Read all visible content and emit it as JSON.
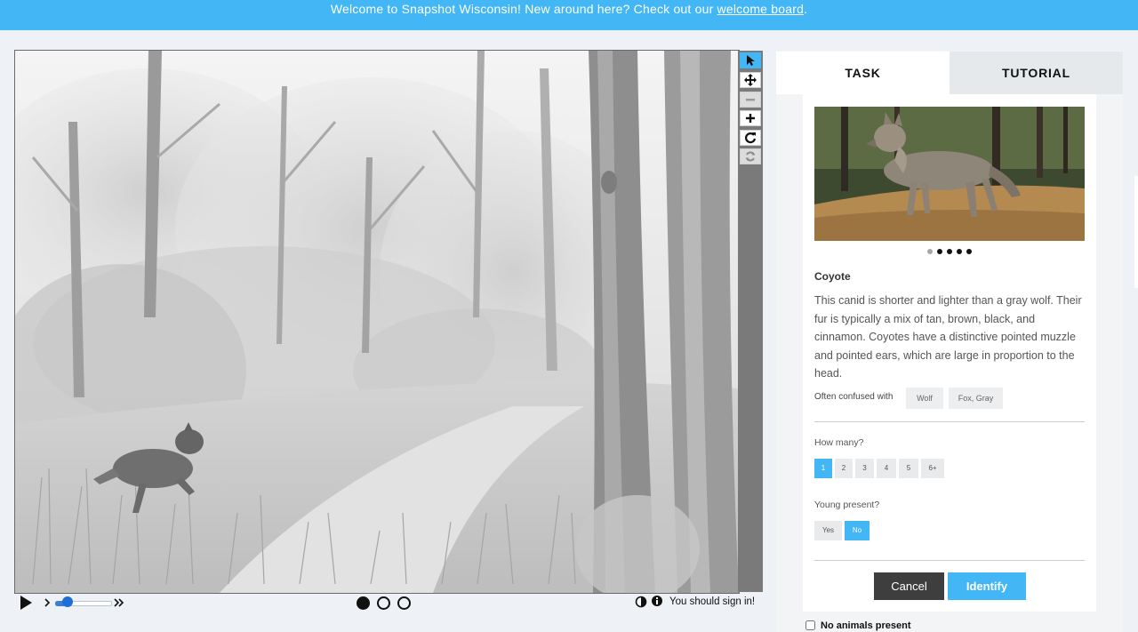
{
  "banner": {
    "text": "Welcome to Snapshot Wisconsin! New around here? Check out our ",
    "link": "welcome board",
    "suffix": "."
  },
  "viewer": {
    "tools": [
      "pointer-icon",
      "move-icon",
      "zoom-out-icon",
      "zoom-in-icon",
      "rotate-icon",
      "reset-icon"
    ],
    "playback": {
      "speed_fraction": 0.15,
      "frames": 3,
      "current_frame": 1
    },
    "signin_text": "You should sign in!"
  },
  "task": {
    "tabs": [
      "TASK",
      "TUTORIAL"
    ],
    "active_tab": "TASK",
    "carousel": {
      "count": 5,
      "current": 1
    },
    "species": {
      "name": "Coyote",
      "description": "This canid is shorter and lighter than a gray wolf. Their fur is typically a mix of tan, brown, black, and cinnamon. Coyotes have a distinctive pointed muzzle and pointed ears, which are large in proportion to the head."
    },
    "confused_label": "Often confused with",
    "confused_with": [
      "Wolf",
      "Fox, Gray"
    ],
    "how_many": {
      "label": "How many?",
      "options": [
        "1",
        "2",
        "3",
        "4",
        "5",
        "6+"
      ],
      "selected": "1"
    },
    "young_present": {
      "label": "Young present?",
      "options": [
        "Yes",
        "No"
      ],
      "selected": "No"
    },
    "cancel_label": "Cancel",
    "identify_label": "Identify",
    "no_animals_label": "No animals present"
  },
  "colors": {
    "accent": "#43b6f5",
    "dark_button": "#3e3e3e"
  }
}
